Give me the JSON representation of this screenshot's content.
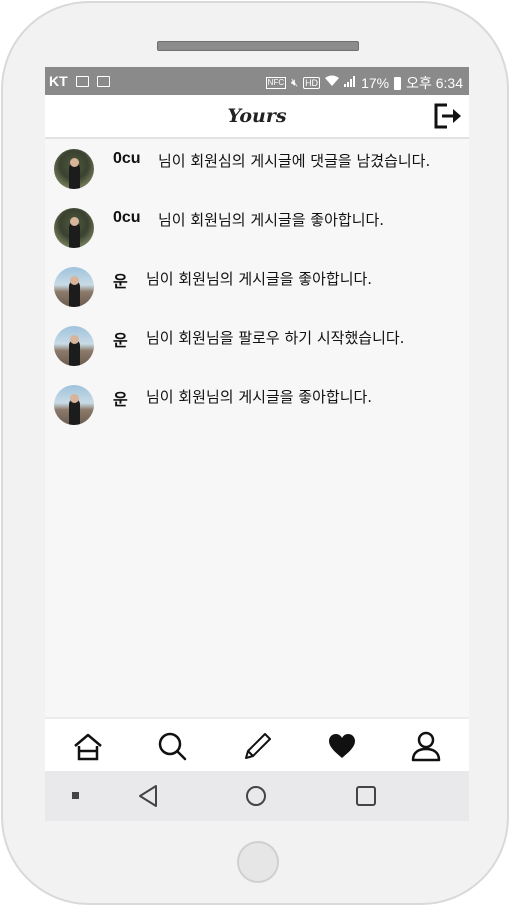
{
  "status_bar": {
    "carrier": "KT",
    "nfc_label": "NFC",
    "hd_label": "HD",
    "battery": "17%",
    "time": "오후 6:34"
  },
  "header": {
    "title": "Yours",
    "logout_icon": "logout-icon"
  },
  "notifications": [
    {
      "user": "0cu",
      "message": "님이 회원심의 게시글에 댓글을 남겼습니다.",
      "avatar": "avatar-green-forest"
    },
    {
      "user": "0cu",
      "message": "님이 회원님의 게시글을 좋아합니다.",
      "avatar": "avatar-green-forest"
    },
    {
      "user": "운",
      "message": "님이 회원님의 게시글을 좋아합니다.",
      "avatar": "avatar-city-sky"
    },
    {
      "user": "운",
      "message": "님이 회원님을 팔로우 하기 시작했습니다.",
      "avatar": "avatar-city-sky"
    },
    {
      "user": "운",
      "message": "님이 회원님의 게시글을 좋아합니다.",
      "avatar": "avatar-city-sky"
    }
  ],
  "tab_bar": {
    "tabs": [
      "home-icon",
      "search-icon",
      "pencil-icon",
      "heart-icon",
      "profile-icon"
    ],
    "active": "heart-icon"
  },
  "nav_bar": [
    "recent-dot",
    "back-icon",
    "home-circle-icon",
    "overview-icon"
  ],
  "colors": {
    "status_bar": "#8a8a8a",
    "screen_bg": "#f7f7f7",
    "nav_bar": "#e9e9ec"
  }
}
